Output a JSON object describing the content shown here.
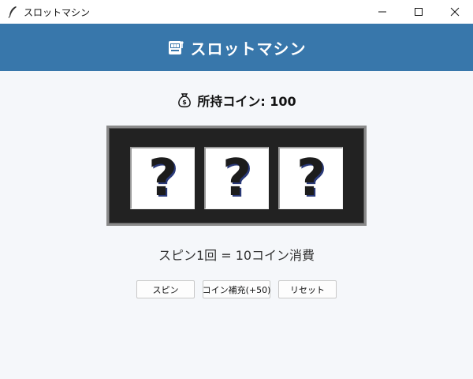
{
  "window": {
    "title": "スロットマシン",
    "controls": [
      "minimize",
      "maximize",
      "close"
    ]
  },
  "header": {
    "title": "スロットマシン",
    "icon": "slot-machine-icon"
  },
  "coins": {
    "label": "所持コイン: 100",
    "icon": "money-bag-icon"
  },
  "reels": [
    "?",
    "?",
    "?"
  ],
  "cost_text": "スピン1回 = 10コイン消費",
  "buttons": {
    "spin": "スピン",
    "add_coins": "コイン補充(+50)",
    "reset": "リセット"
  },
  "colors": {
    "header_bg": "#3877ab",
    "machine_bg": "#222222",
    "background": "#f5f7fa"
  }
}
